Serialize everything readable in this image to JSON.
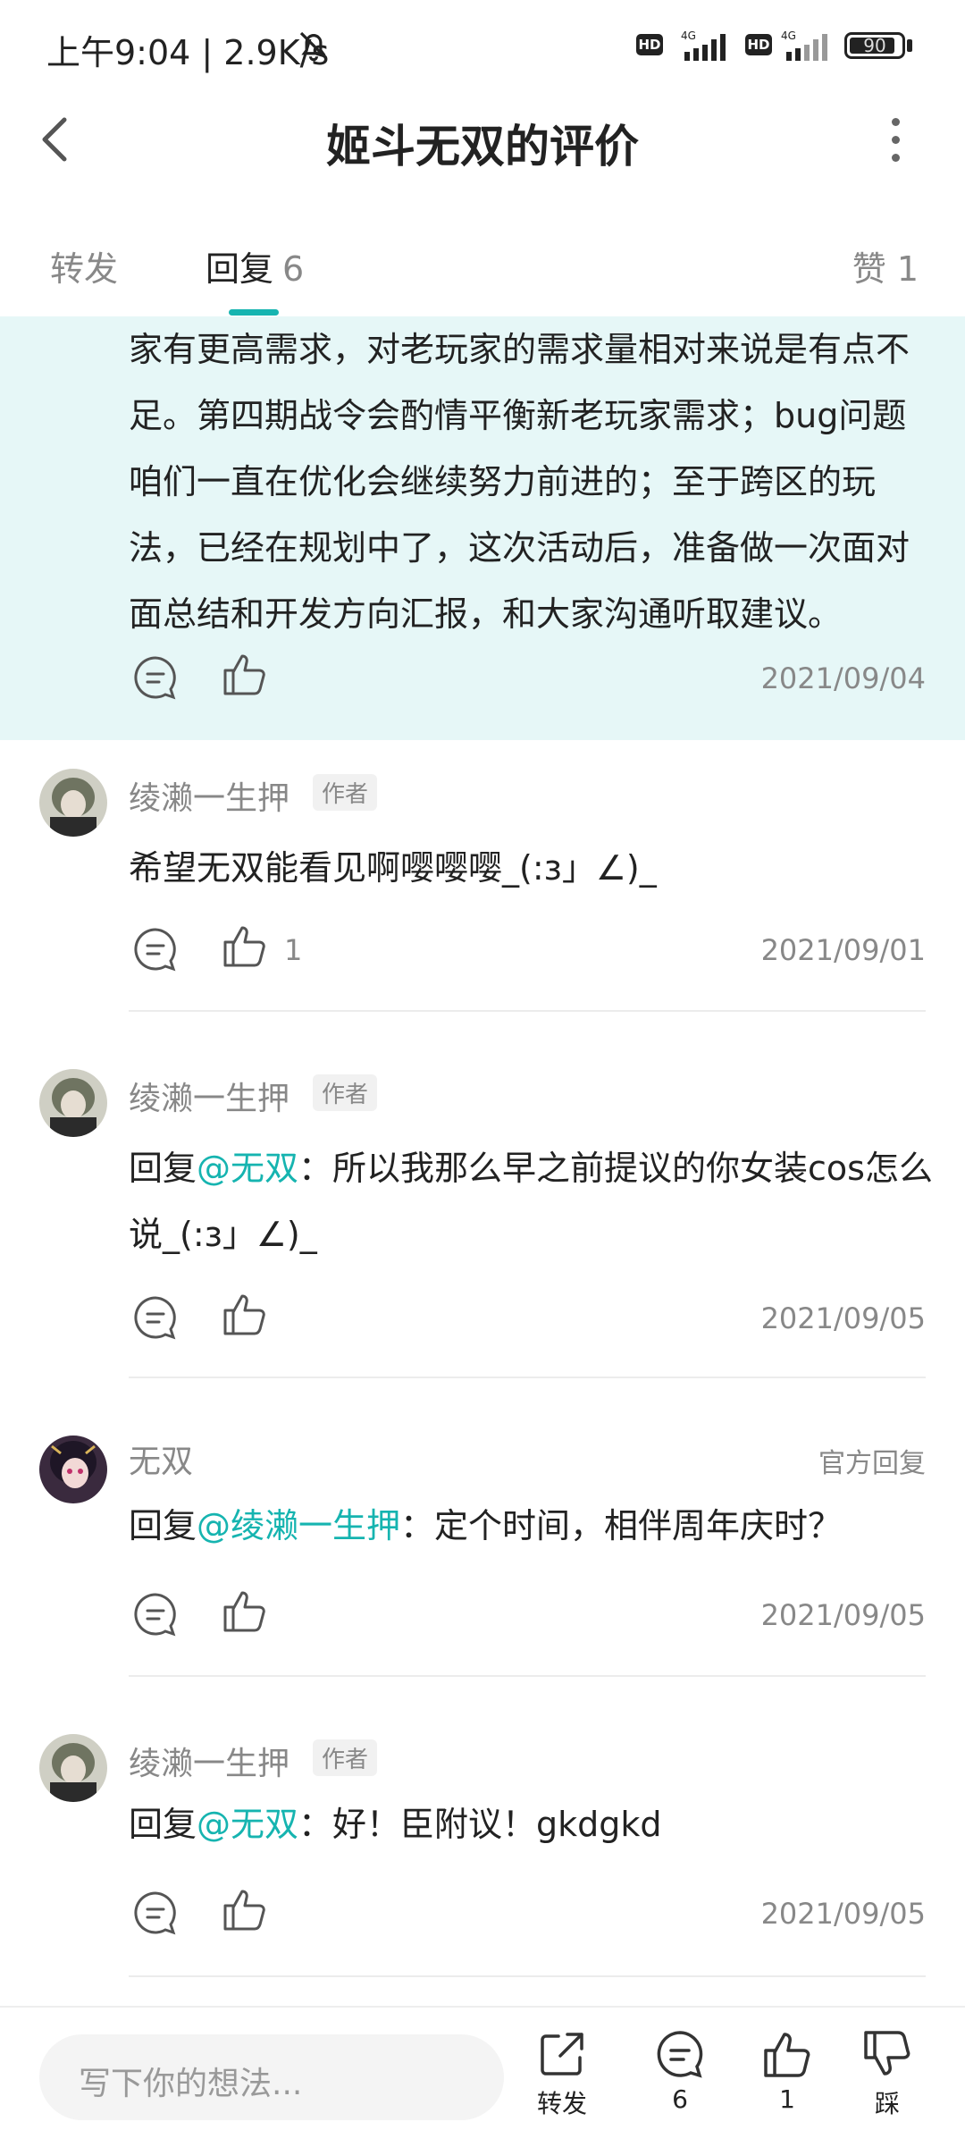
{
  "status_bar": {
    "time": "上午9:04 | 2.9K/s",
    "hd1": "HD",
    "net1": "4G",
    "hd2": "HD",
    "net2": "4G",
    "battery": "90",
    "battery_level": 0.9
  },
  "header": {
    "title": "姬斗无双的评价"
  },
  "tabs": {
    "repost": "转发",
    "reply": "回复",
    "reply_count": "6",
    "like": "赞 1"
  },
  "highlight": {
    "text": "家有更高需求，对老玩家的需求量相对来说是有点不足。第四期战令会酌情平衡新老玩家需求；bug问题咱们一直在优化会继续努力前进的；至于跨区的玩法，已经在规划中了，这次活动后，准备做一次面对面总结和开发方向汇报，和大家沟通听取建议。",
    "date": "2021/09/04"
  },
  "comments": [
    {
      "user": "绫濑一生押",
      "badge": "作者",
      "text": "希望无双能看见啊嘤嘤嘤_(:з」∠)_",
      "likes": "1",
      "date": "2021/09/01"
    },
    {
      "user": "绫濑一生押",
      "badge": "作者",
      "prefix": "回复",
      "mention": "@无双",
      "text": "：所以我那么早之前提议的你女装cos怎么说_(:з」∠)_",
      "date": "2021/09/05"
    },
    {
      "user": "无双",
      "official": "官方回复",
      "prefix": "回复",
      "mention": "@绫濑一生押",
      "text": "：定个时间，相伴周年庆时？",
      "date": "2021/09/05"
    },
    {
      "user": "绫濑一生押",
      "badge": "作者",
      "prefix": "回复",
      "mention": "@无双",
      "text": "：好！臣附议！gkdgkd",
      "date": "2021/09/05"
    }
  ],
  "bottom_bar": {
    "placeholder": "写下你的想法...",
    "repost": "转发",
    "comments": "6",
    "likes": "1",
    "dislike": "踩"
  },
  "colors": {
    "accent": "#16b4b0",
    "highlight_bg": "#e6f7f7"
  }
}
